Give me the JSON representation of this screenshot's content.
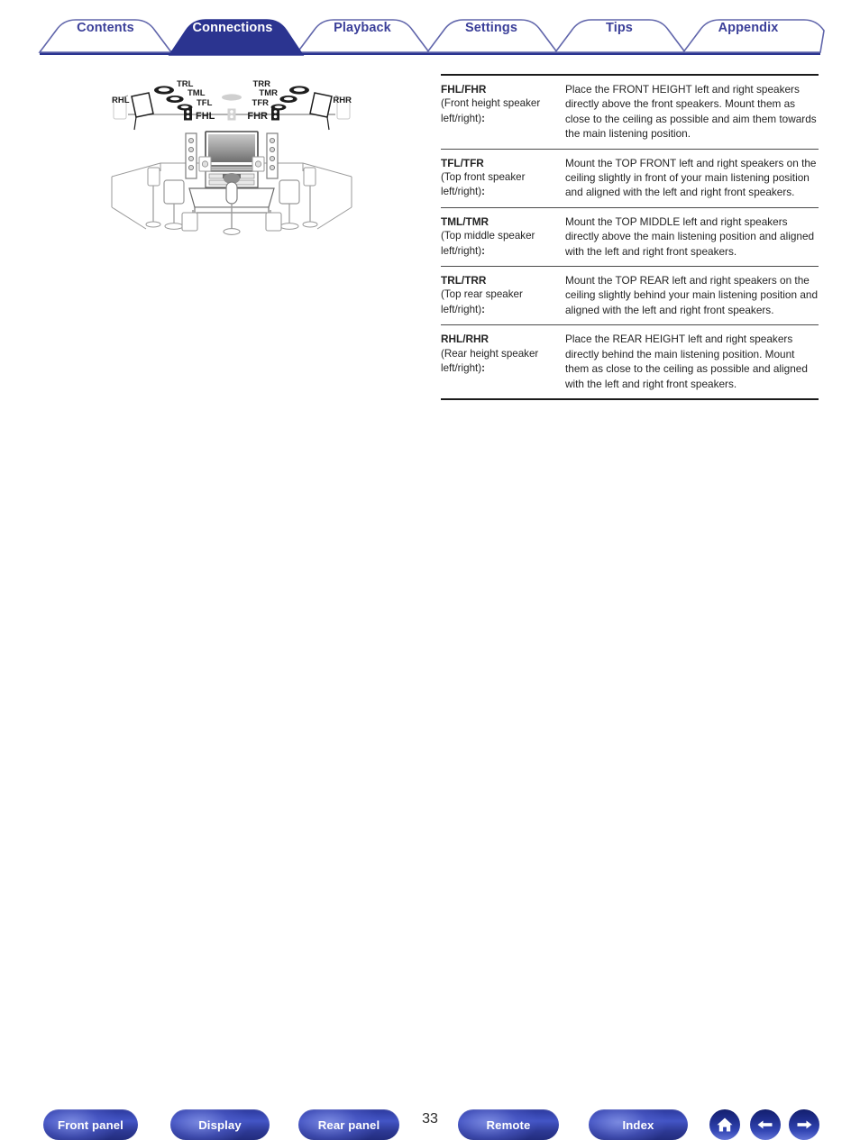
{
  "tabs": [
    {
      "label": "Contents",
      "active": false
    },
    {
      "label": "Connections",
      "active": true
    },
    {
      "label": "Playback",
      "active": false
    },
    {
      "label": "Settings",
      "active": false
    },
    {
      "label": "Tips",
      "active": false
    },
    {
      "label": "Appendix",
      "active": false
    }
  ],
  "diagram": {
    "name": "speaker-layout-room-diagram",
    "ceiling_labels": [
      "TRL",
      "TML",
      "TFL",
      "TRR",
      "TMR",
      "TFR"
    ],
    "wall_labels": [
      "RHL",
      "RHR",
      "FHL",
      "FHR"
    ]
  },
  "table": {
    "rows": [
      {
        "code": "FHL/FHR",
        "desc": "(Front height speaker left/right)",
        "value": "Place the FRONT HEIGHT left and right speakers directly above the front speakers. Mount them as close to the ceiling as possible and aim them towards the main listening position."
      },
      {
        "code": "TFL/TFR",
        "desc": "(Top front speaker left/right)",
        "value": "Mount the TOP FRONT left and right speakers on the ceiling slightly in front of your main listening position and aligned with the left and right front speakers."
      },
      {
        "code": "TML/TMR",
        "desc": "(Top middle speaker left/right)",
        "value": "Mount the TOP MIDDLE left and right speakers directly above the main listening position and aligned with the left and right front speakers."
      },
      {
        "code": "TRL/TRR",
        "desc": "(Top rear speaker left/right)",
        "value": "Mount the TOP REAR left and right speakers on the ceiling slightly behind your main listening position and aligned with the left and right front speakers."
      },
      {
        "code": "RHL/RHR",
        "desc": "(Rear height speaker left/right)",
        "value": "Place the REAR HEIGHT left and right speakers directly behind the main listening position. Mount them as close to the ceiling as possible and aligned with the left and right front speakers."
      }
    ]
  },
  "footer": {
    "page_number": "33",
    "buttons": [
      {
        "label": "Front panel",
        "name": "front-panel-button"
      },
      {
        "label": "Display",
        "name": "display-button"
      },
      {
        "label": "Rear panel",
        "name": "rear-panel-button"
      },
      {
        "label": "Remote",
        "name": "remote-button"
      },
      {
        "label": "Index",
        "name": "index-button"
      }
    ],
    "icon_buttons": [
      {
        "name": "home-icon"
      },
      {
        "name": "arrow-left-icon"
      },
      {
        "name": "arrow-right-icon"
      }
    ]
  },
  "colors": {
    "brand_blue": "#2b3490",
    "tab_text": "#3b3f99",
    "active_tab_bg": "#2b3490",
    "text": "#242424"
  }
}
